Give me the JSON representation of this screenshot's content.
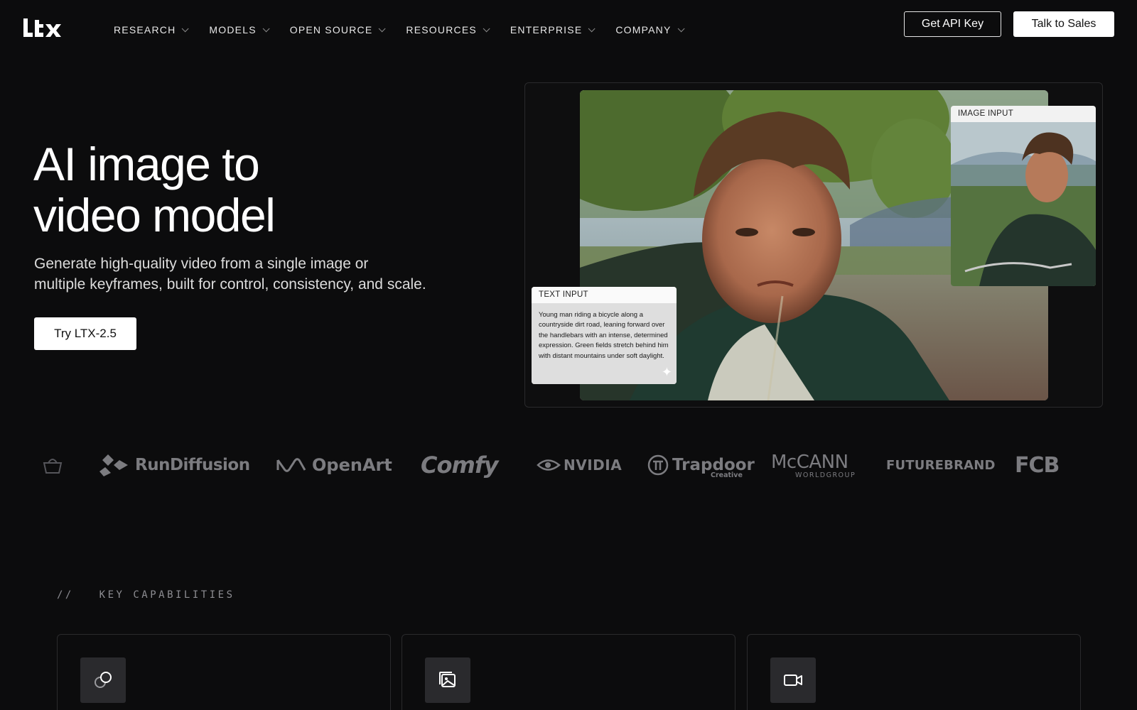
{
  "nav": {
    "brand": "LtX",
    "items": [
      {
        "label": "RESEARCH"
      },
      {
        "label": "MODELS"
      },
      {
        "label": "OPEN SOURCE"
      },
      {
        "label": "RESOURCES"
      },
      {
        "label": "ENTERPRISE"
      },
      {
        "label": "COMPANY"
      }
    ],
    "api_key_label": "Get API Key",
    "sales_label": "Talk to Sales"
  },
  "hero": {
    "title_line1": "AI image to",
    "title_line2": "video model",
    "subtitle_line1": "Generate high-quality video from a single image or",
    "subtitle_line2": "multiple keyframes, built for control, consistency, and scale.",
    "cta_label": "Try LTX-2.5"
  },
  "media": {
    "image_input_label": "IMAGE INPUT",
    "text_input_label": "TEXT INPUT",
    "prompt": "Young man riding a bicycle along a countryside dirt road, leaning forward over the handlebars with an intense, determined expression. Green fields stretch behind him with distant mountains under soft daylight."
  },
  "logos": {
    "rundiffusion": "RunDiffusion",
    "openart": "OpenArt",
    "comfy": "Comfy",
    "nvidia": "NVIDIA",
    "trapdoor": "Trapdoor",
    "trapdoor_sub": "Creative",
    "mccann": "McCANN",
    "mccann_sub": "WORLDGROUP",
    "futurebrand": "FUTUREBRAND",
    "fcb": "FCB"
  },
  "capabilities": {
    "section_label": "//   KEY CAPABILITIES",
    "cards": [
      {
        "icon": "link-circles-icon"
      },
      {
        "icon": "images-icon"
      },
      {
        "icon": "video-camera-icon"
      }
    ]
  },
  "colors": {
    "background": "#0c0c0d",
    "logo_gray": "#7c7c80",
    "card_border": "#2a2a2c"
  }
}
